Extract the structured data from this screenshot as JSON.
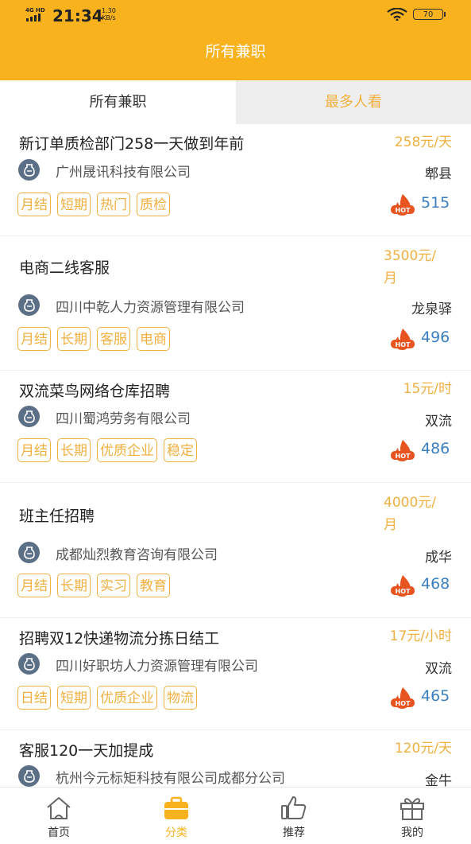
{
  "status_bar": {
    "network": "4G HD",
    "time": "21:34",
    "speed_value": "1.30",
    "speed_unit": "KB/s",
    "battery": "70"
  },
  "header": {
    "title": "所有兼职"
  },
  "tabs": [
    {
      "label": "所有兼职",
      "active": true
    },
    {
      "label": "最多人看",
      "active": false
    }
  ],
  "jobs": [
    {
      "title": "新订单质检部门258一天做到年前",
      "salary_line1": "258元/天",
      "salary_line2": "",
      "company": "广州晟讯科技有限公司",
      "location": "郫县",
      "tags": [
        "月结",
        "短期",
        "热门",
        "质检"
      ],
      "views": "515"
    },
    {
      "title": "电商二线客服",
      "salary_line1": "3500元/",
      "salary_line2": "月",
      "company": "四川中乾人力资源管理有限公司",
      "location": "龙泉驿",
      "tags": [
        "月结",
        "长期",
        "客服",
        "电商"
      ],
      "views": "496"
    },
    {
      "title": "双流菜鸟网络仓库招聘",
      "salary_line1": "15元/时",
      "salary_line2": "",
      "company": "四川蜀鸿劳务有限公司",
      "location": "双流",
      "tags": [
        "月结",
        "长期",
        "优质企业",
        "稳定"
      ],
      "views": "486"
    },
    {
      "title": "班主任招聘",
      "salary_line1": "4000元/",
      "salary_line2": "月",
      "company": "成都灿烈教育咨询有限公司",
      "location": "成华",
      "tags": [
        "月结",
        "长期",
        "实习",
        "教育"
      ],
      "views": "468"
    },
    {
      "title": "招聘双12快递物流分拣日结工",
      "salary_line1": "17元/小时",
      "salary_line2": "",
      "company": "四川好职坊人力资源管理有限公司",
      "location": "双流",
      "tags": [
        "日结",
        "短期",
        "优质企业",
        "物流"
      ],
      "views": "465"
    },
    {
      "title": "客服120一天加提成",
      "salary_line1": "120元/天",
      "salary_line2": "",
      "company": "杭州今元标矩科技有限公司成都分公司",
      "location": "金牛",
      "tags": [],
      "views": ""
    }
  ],
  "bottom_nav": [
    {
      "label": "首页",
      "icon": "home-icon",
      "active": false
    },
    {
      "label": "分类",
      "icon": "briefcase-icon",
      "active": true
    },
    {
      "label": "推荐",
      "icon": "thumbs-up-icon",
      "active": false
    },
    {
      "label": "我的",
      "icon": "gift-icon",
      "active": false
    }
  ],
  "colors": {
    "accent": "#f7b21e",
    "tag": "#f0b040",
    "views": "#3a7fc0",
    "hot": "#e8541f"
  }
}
